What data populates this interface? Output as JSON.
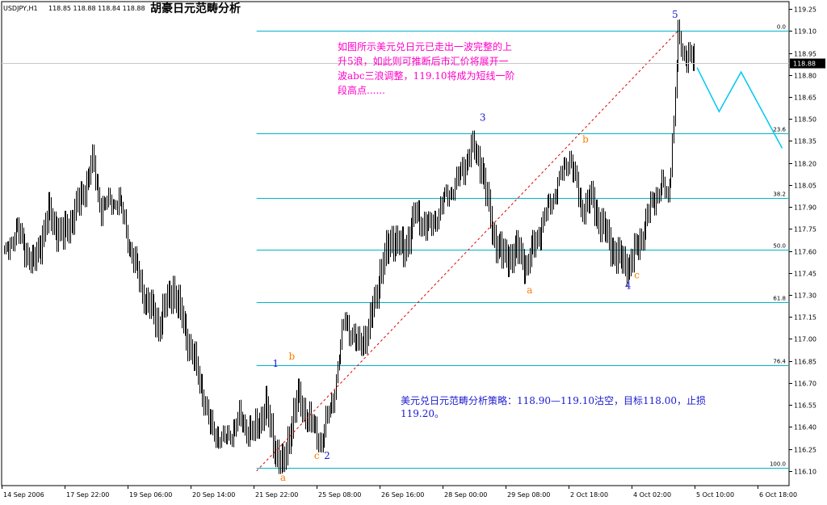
{
  "header": {
    "symbol": "USDJPY,H1",
    "ohlc": "118.85 118.88 118.84 118.88",
    "title": "胡豪日元范畴分析"
  },
  "price_badge": "118.88",
  "colors": {
    "bar": "#000000",
    "fib": "#00b4c8",
    "trend": "#e00000",
    "projection": "#00c8f0",
    "wave_main": "#1a1ad0",
    "wave_sub": "#ff7a00",
    "annotation_top": "#ff00c8",
    "annotation_bottom": "#1a1ad0",
    "badge_bg": "#000000",
    "badge_fg": "#ffffff"
  },
  "annotations": {
    "top": [
      "如图所示美元兑日元已走出一波完整的上",
      "升5浪，如此则可推断后市汇价将展开一",
      "波abc三浪调整，119.10将成为短线一阶",
      "段高点......"
    ],
    "bottom": [
      "美元兑日元范畴分析策略：118.90—119.10沽空，目标118.00，止损",
      "119.20。"
    ]
  },
  "chart_data": {
    "type": "candlestick",
    "timeframe": "H1",
    "ylim": [
      116.0,
      119.3
    ],
    "yticks": [
      "119.25",
      "119.10",
      "118.95",
      "118.80",
      "118.65",
      "118.50",
      "118.35",
      "118.20",
      "118.05",
      "117.90",
      "117.75",
      "117.60",
      "117.45",
      "117.30",
      "117.15",
      "117.00",
      "116.85",
      "116.70",
      "116.55",
      "116.40",
      "116.25",
      "116.10"
    ],
    "xtick_labels": [
      "14 Sep 2006",
      "17 Sep 22:00",
      "19 Sep 06:00",
      "20 Sep 14:00",
      "21 Sep 22:00",
      "25 Sep 08:00",
      "26 Sep 16:00",
      "28 Sep 00:00",
      "29 Sep 08:00",
      "2 Oct 18:00",
      "4 Oct 02:00",
      "5 Oct 10:00",
      "6 Oct 18:00"
    ],
    "price_path": [
      {
        "i": 0,
        "p": 117.55
      },
      {
        "i": 8,
        "p": 117.75
      },
      {
        "i": 20,
        "p": 117.5
      },
      {
        "i": 30,
        "p": 117.85
      },
      {
        "i": 40,
        "p": 117.7
      },
      {
        "i": 52,
        "p": 117.95
      },
      {
        "i": 60,
        "p": 118.2
      },
      {
        "i": 66,
        "p": 117.9
      },
      {
        "i": 78,
        "p": 117.95
      },
      {
        "i": 85,
        "p": 117.65
      },
      {
        "i": 95,
        "p": 117.3
      },
      {
        "i": 105,
        "p": 117.1
      },
      {
        "i": 115,
        "p": 117.35
      },
      {
        "i": 125,
        "p": 117.0
      },
      {
        "i": 135,
        "p": 116.65
      },
      {
        "i": 140,
        "p": 116.4
      },
      {
        "i": 150,
        "p": 116.3
      },
      {
        "i": 160,
        "p": 116.45
      },
      {
        "i": 170,
        "p": 116.35
      },
      {
        "i": 178,
        "p": 116.55
      },
      {
        "i": 183,
        "p": 116.3
      },
      {
        "i": 190,
        "p": 116.12
      },
      {
        "i": 195,
        "p": 116.4
      },
      {
        "i": 200,
        "p": 116.6
      },
      {
        "i": 210,
        "p": 116.4
      },
      {
        "i": 216,
        "p": 116.3
      },
      {
        "i": 224,
        "p": 116.6
      },
      {
        "i": 232,
        "p": 117.15
      },
      {
        "i": 240,
        "p": 116.95
      },
      {
        "i": 248,
        "p": 117.05
      },
      {
        "i": 256,
        "p": 117.45
      },
      {
        "i": 264,
        "p": 117.7
      },
      {
        "i": 272,
        "p": 117.6
      },
      {
        "i": 280,
        "p": 117.85
      },
      {
        "i": 290,
        "p": 117.75
      },
      {
        "i": 300,
        "p": 117.95
      },
      {
        "i": 310,
        "p": 118.1
      },
      {
        "i": 318,
        "p": 118.3
      },
      {
        "i": 325,
        "p": 118.2
      },
      {
        "i": 332,
        "p": 117.75
      },
      {
        "i": 340,
        "p": 117.55
      },
      {
        "i": 350,
        "p": 117.6
      },
      {
        "i": 356,
        "p": 117.5
      },
      {
        "i": 365,
        "p": 117.75
      },
      {
        "i": 375,
        "p": 118.0
      },
      {
        "i": 385,
        "p": 118.25
      },
      {
        "i": 393,
        "p": 117.9
      },
      {
        "i": 400,
        "p": 117.95
      },
      {
        "i": 408,
        "p": 117.75
      },
      {
        "i": 418,
        "p": 117.55
      },
      {
        "i": 426,
        "p": 117.5
      },
      {
        "i": 434,
        "p": 117.7
      },
      {
        "i": 442,
        "p": 117.95
      },
      {
        "i": 448,
        "p": 118.05
      },
      {
        "i": 452,
        "p": 117.95
      },
      {
        "i": 456,
        "p": 118.5
      },
      {
        "i": 459,
        "p": 119.05
      },
      {
        "i": 462,
        "p": 118.95
      },
      {
        "i": 466,
        "p": 118.95
      },
      {
        "i": 470,
        "p": 118.87
      }
    ],
    "fibonacci_levels": [
      {
        "label": "0.0",
        "price": 119.1
      },
      {
        "label": "23.6",
        "price": 118.4
      },
      {
        "label": "38.2",
        "price": 117.96
      },
      {
        "label": "50.0",
        "price": 117.61
      },
      {
        "label": "61.8",
        "price": 117.25
      },
      {
        "label": "76.4",
        "price": 116.82
      },
      {
        "label": "100.0",
        "price": 116.12
      }
    ],
    "wave_labels": [
      {
        "label": "1",
        "style": "main",
        "bar": 185,
        "price": 116.77,
        "pos": "above"
      },
      {
        "label": "b",
        "style": "sub",
        "bar": 196,
        "price": 116.82,
        "pos": "above"
      },
      {
        "label": "a",
        "style": "sub",
        "bar": 190,
        "price": 116.12,
        "pos": "below"
      },
      {
        "label": "c",
        "style": "sub",
        "bar": 213,
        "price": 116.27,
        "pos": "below"
      },
      {
        "label": "2",
        "style": "main",
        "bar": 220,
        "price": 116.27,
        "pos": "below"
      },
      {
        "label": "3",
        "style": "main",
        "bar": 326,
        "price": 118.45,
        "pos": "above"
      },
      {
        "label": "a",
        "style": "sub",
        "bar": 358,
        "price": 117.4,
        "pos": "below"
      },
      {
        "label": "b",
        "style": "sub",
        "bar": 396,
        "price": 118.3,
        "pos": "above"
      },
      {
        "label": "4",
        "style": "main",
        "bar": 425,
        "price": 117.43,
        "pos": "below"
      },
      {
        "label": "c",
        "style": "sub",
        "bar": 431,
        "price": 117.5,
        "pos": "below"
      },
      {
        "label": "5",
        "style": "main",
        "bar": 457,
        "price": 119.15,
        "pos": "above"
      }
    ],
    "trendline": {
      "from": {
        "bar": 172,
        "price": 116.1
      },
      "to": {
        "bar": 459,
        "price": 119.1
      }
    },
    "projection": [
      {
        "bar": 472,
        "price": 118.85
      },
      {
        "bar": 487,
        "price": 118.55
      },
      {
        "bar": 502,
        "price": 118.82
      },
      {
        "bar": 530,
        "price": 118.3
      }
    ],
    "current_price": 118.88
  }
}
